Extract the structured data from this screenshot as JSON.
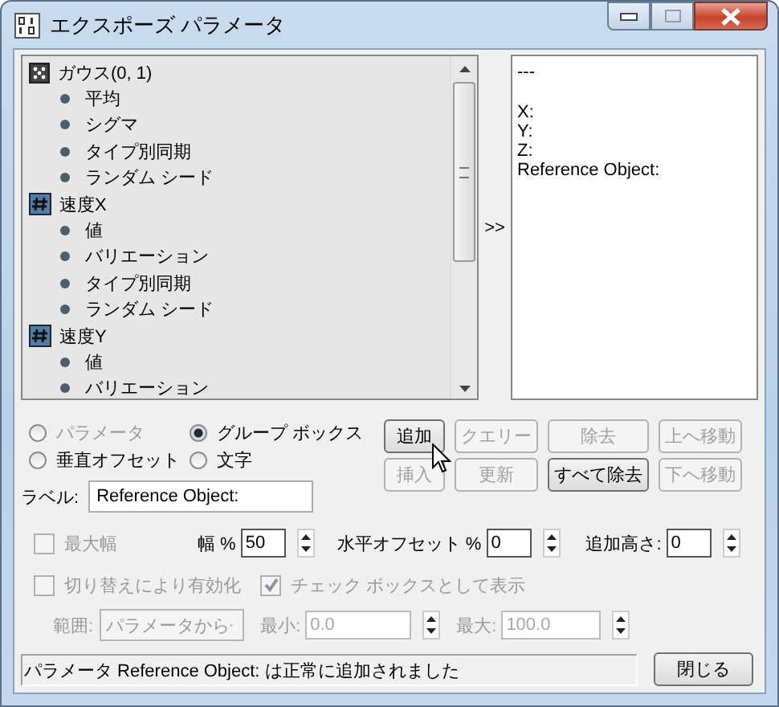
{
  "window": {
    "title": "エクスポーズ パラメータ"
  },
  "tree": {
    "items": [
      {
        "label": "ガウス(0, 1)",
        "kind": "random",
        "children": [
          {
            "label": "平均"
          },
          {
            "label": "シグマ"
          },
          {
            "label": "タイプ別同期"
          },
          {
            "label": "ランダム シード"
          }
        ]
      },
      {
        "label": "速度X",
        "kind": "numeric",
        "children": [
          {
            "label": "値"
          },
          {
            "label": "バリエーション"
          },
          {
            "label": "タイプ別同期"
          },
          {
            "label": "ランダム シード"
          }
        ]
      },
      {
        "label": "速度Y",
        "kind": "numeric",
        "children": [
          {
            "label": "値"
          },
          {
            "label": "バリエーション"
          }
        ]
      }
    ]
  },
  "arrow": ">>",
  "preview": {
    "lines": [
      {
        "text": "---",
        "gap_after": true
      },
      {
        "text": "X:",
        "gap_after": false
      },
      {
        "text": "Y:",
        "gap_after": false
      },
      {
        "text": "Z:",
        "gap_after": false
      },
      {
        "text": "Reference Object:",
        "gap_after": false
      }
    ]
  },
  "type_options": [
    {
      "label": "パラメータ",
      "selected": false,
      "disabled": true
    },
    {
      "label": "グループ ボックス",
      "selected": true,
      "disabled": false
    },
    {
      "label": "垂直オフセット",
      "selected": false,
      "disabled": false
    },
    {
      "label": "文字",
      "selected": false,
      "disabled": false
    }
  ],
  "buttons": [
    {
      "label": "追加",
      "disabled": false
    },
    {
      "label": "クエリー",
      "disabled": true
    },
    {
      "label": "除去",
      "disabled": true
    },
    {
      "label": "上へ移動",
      "disabled": true
    },
    {
      "label": "挿入",
      "disabled": true
    },
    {
      "label": "更新",
      "disabled": true
    },
    {
      "label": "すべて除去",
      "disabled": false
    },
    {
      "label": "下へ移動",
      "disabled": true
    }
  ],
  "label_field": {
    "label": "ラベル:",
    "value": "Reference Object:"
  },
  "max_width": {
    "label": "最大幅",
    "checked": false,
    "disabled": true
  },
  "spinners": [
    {
      "label": "幅 %",
      "value": "50"
    },
    {
      "label": "水平オフセット %",
      "value": "0"
    },
    {
      "label": "追加高さ:",
      "value": "0"
    }
  ],
  "checkboxes": [
    {
      "label": "切り替えにより有効化",
      "checked": false,
      "disabled": true
    },
    {
      "label": "チェック ボックスとして表示",
      "checked": true,
      "disabled": true
    }
  ],
  "range": {
    "label": "範囲:",
    "value": "パラメータから",
    "disabled": true
  },
  "limits": [
    {
      "label": "最小:",
      "value": "0.0",
      "disabled": true
    },
    {
      "label": "最大:",
      "value": "100.0",
      "disabled": true
    }
  ],
  "status": "パラメータ Reference Object: は正常に追加されました",
  "close_button": "閉じる"
}
